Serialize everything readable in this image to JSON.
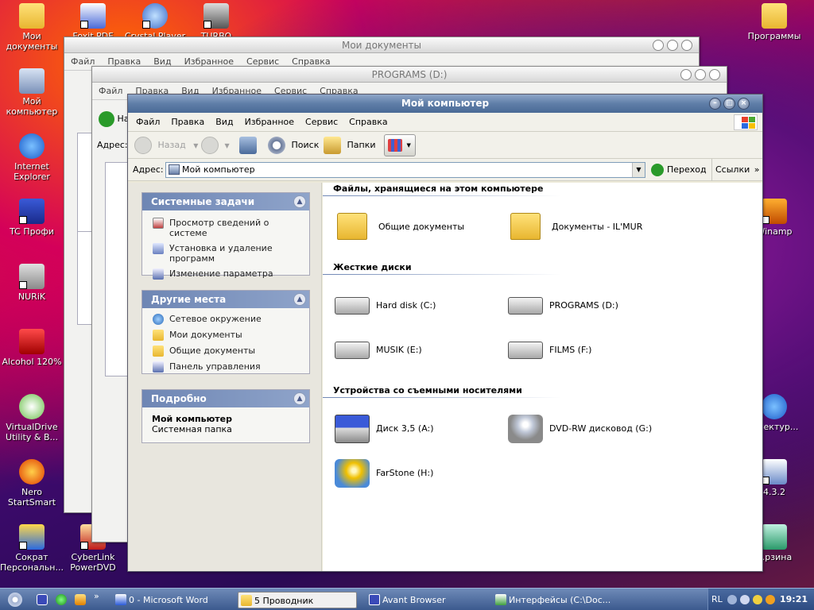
{
  "desktop": {
    "icons": [
      {
        "label": "Мои документы"
      },
      {
        "label": "Мой компьютер"
      },
      {
        "label": "Internet Explorer"
      },
      {
        "label": "TC Профи"
      },
      {
        "label": "NURiK"
      },
      {
        "label": "Alcohol 120%"
      },
      {
        "label": "VirtualDrive Utility & B..."
      },
      {
        "label": "Nero StartSmart"
      },
      {
        "label": "Сократ Персональн..."
      },
      {
        "label": "Foxit PDF"
      },
      {
        "label": "Crystal Player"
      },
      {
        "label": "TURBO"
      },
      {
        "label": "CyberLink PowerDVD"
      },
      {
        "label": "Программы"
      },
      {
        "label": "Winamp"
      },
      {
        "label": "...тектур..."
      },
      {
        "label": "4.3.2"
      },
      {
        "label": "...рзина"
      }
    ]
  },
  "bg_windows": {
    "docs": {
      "title": "Мои документы",
      "menu": [
        "Файл",
        "Правка",
        "Вид",
        "Избранное",
        "Сервис",
        "Справка"
      ]
    },
    "programs": {
      "title": "PROGRAMS (D:)",
      "menu": [
        "Файл",
        "Правка",
        "Вид",
        "Избранное",
        "Сервис",
        "Справка"
      ],
      "addr": "Адрес:",
      "back": "На"
    }
  },
  "window": {
    "title": "Мой компьютер",
    "menu": [
      "Файл",
      "Правка",
      "Вид",
      "Избранное",
      "Сервис",
      "Справка"
    ],
    "toolbar": {
      "back": "Назад",
      "search": "Поиск",
      "folders": "Папки"
    },
    "address": {
      "label": "Адрес:",
      "value": "Мой компьютер",
      "go": "Переход",
      "links": "Ссылки"
    }
  },
  "panels": {
    "system": {
      "title": "Системные задачи",
      "items": [
        "Просмотр сведений о системе",
        "Установка и удаление программ",
        "Изменение параметра"
      ]
    },
    "places": {
      "title": "Другие места",
      "items": [
        "Сетевое окружение",
        "Мои документы",
        "Общие документы",
        "Панель управления"
      ]
    },
    "details": {
      "title": "Подробно",
      "name": "Мой компьютер",
      "type": "Системная папка"
    }
  },
  "content": {
    "files_header": "Файлы, хранящиеся на этом компьютере",
    "files": [
      "Общие документы",
      "Документы - IL'MUR"
    ],
    "hdd_header": "Жесткие диски",
    "drives": [
      "Hard disk (C:)",
      "PROGRAMS (D:)",
      "MUSIK (E:)",
      "FILMS (F:)"
    ],
    "removable_header": "Устройства со съемными носителями",
    "removable": [
      "Диск 3,5 (A:)",
      "DVD-RW дисковод (G:)",
      "FarStone (H:)"
    ]
  },
  "taskbar": {
    "tasks": [
      "0 - Microsoft Word",
      "5 Проводник",
      "Avant Browser",
      "Интерфейсы (C:\\Doc..."
    ],
    "lang": "RL",
    "clock": "19:21"
  }
}
